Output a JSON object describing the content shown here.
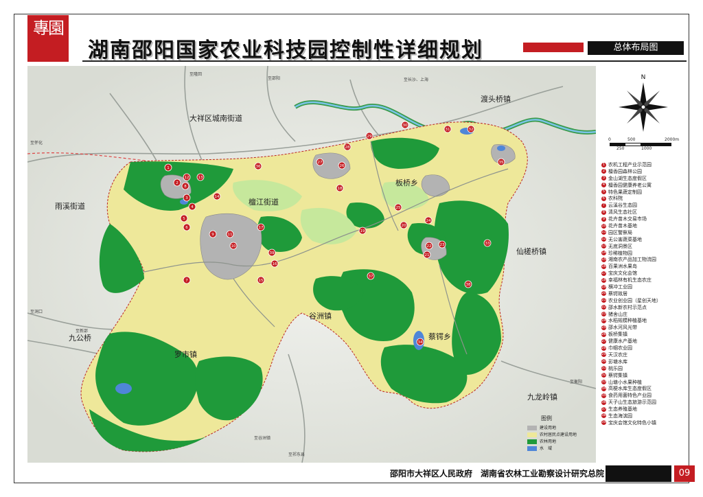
{
  "header": {
    "seal_text": "專園",
    "title": "湖南邵阳国家农业科技园控制性详细规划",
    "subtitle": "总体布局图"
  },
  "footer": {
    "organizations": "邵阳市大祥区人民政府　湖南省农林工业勘察设计研究总院",
    "page_number": "09"
  },
  "colors": {
    "accent_red": "#c41d22",
    "forest_green": "#1f9a3a",
    "farmland_yellow": "#eee89a",
    "light_green": "#c6e89c",
    "water_blue": "#4f86d8",
    "construction_gray": "#b3b3b3"
  },
  "map": {
    "place_labels": {
      "dukou": "渡头桥镇",
      "chengnan": "大祥区城南街道",
      "yuxi": "雨溪街道",
      "tanjiang": "檀江街道",
      "banqiao": "板桥乡",
      "xiancha": "仙槎桥镇",
      "guzhou": "谷洲镇",
      "jiugong": "九公桥",
      "luoshi": "罗市镇",
      "caie": "蔡锷乡",
      "jiulongling": "九龙岭镇"
    },
    "road_labels": {
      "zhiyang": "至隆回",
      "zhishaoyang": "至邵阳",
      "zhihuaihua": "至怀化",
      "zhishanghai": "至长沙、上海",
      "zhihengyang": "至衡阳",
      "zhixinshao": "至新邵",
      "zhidongkou": "至洞口",
      "zhiqidong": "至祁东县",
      "zhiguzhou": "至谷洲镇"
    },
    "legend_title": "图例",
    "legend_items": [
      {
        "label": "建设用地",
        "color": "#b3b3b3"
      },
      {
        "label": "农村居民点建设用地",
        "color": "#eee89a"
      },
      {
        "label": "农林用地",
        "color": "#1f9a3a"
      },
      {
        "label": "水　域",
        "color": "#4f86d8"
      }
    ]
  },
  "compass": {
    "north": "N"
  },
  "scale": {
    "top": [
      "0",
      "500",
      "2000m"
    ],
    "bottom": [
      "250",
      "1000"
    ]
  },
  "projects": [
    "农机工程产业示范园",
    "檀香园森林公园",
    "金山湖生态度假区",
    "檀香园健康养老公寓",
    "特色果蔬定制园",
    "农科院",
    "云溪谷生态园",
    "清风生态社区",
    "花卉苗木交易市场",
    "花卉苗木基地",
    "园区警察局",
    "无公害蔬菜基地",
    "无底洞景区",
    "珍稀植物园",
    "湘南农产品加工物流园",
    "百果洲水果岛",
    "宝庆文化会馆",
    "幸福林有机生态农庄",
    "横冲工业园",
    "蔡锷故居",
    "农业创业园（星创天地）",
    "邵水新农村示范点",
    "猪舍山庄",
    "水稻规模种植基地",
    "邵水河风光带",
    "板桥集镇",
    "健康水产基地",
    "巾帼农业园",
    "天汉农庄",
    "彭塘水库",
    "桃乐园",
    "蔡锷集镇",
    "山塘小水果种植",
    "高梗水库生态度假区",
    "食药用菌特色产业园",
    "天子山生态旅游示范园",
    "生态养殖基地",
    "生态海滨园",
    "宝庆会馆文化特色小镇"
  ]
}
